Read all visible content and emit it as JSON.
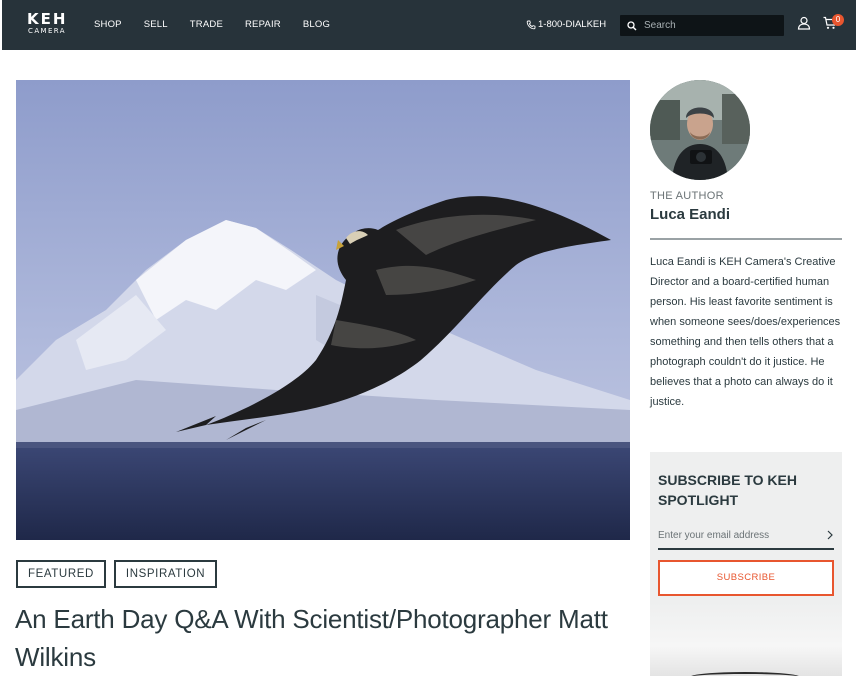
{
  "header": {
    "logo_main": "KEH",
    "logo_sub": "CAMERA",
    "nav": [
      "SHOP",
      "SELL",
      "TRADE",
      "REPAIR",
      "BLOG"
    ],
    "phone": "1-800-DIALKEH",
    "search_placeholder": "Search",
    "cart_count": "0"
  },
  "article": {
    "tags": [
      "FEATURED",
      "INSPIRATION"
    ],
    "title": "An Earth Day Q&A With Scientist/Photographer Matt Wilkins"
  },
  "author": {
    "kicker": "THE AUTHOR",
    "name": "Luca Eandi",
    "bio": "Luca Eandi is KEH Camera's Creative Director and a board-certified human person. His least favorite sentiment is when someone sees/does/experiences something and then tells others that a photograph couldn't do it justice. He believes that a photo can always do it justice."
  },
  "subscribe": {
    "title": "SUBSCRIBE TO KEH SPOTLIGHT",
    "email_placeholder": "Enter your email address",
    "button": "SUBSCRIBE"
  },
  "colors": {
    "header_bg": "#27333a",
    "accent": "#e8562f",
    "text": "#2b3a3f"
  },
  "icons": [
    "phone-icon",
    "search-icon",
    "user-icon",
    "cart-icon",
    "chevron-right-icon"
  ]
}
